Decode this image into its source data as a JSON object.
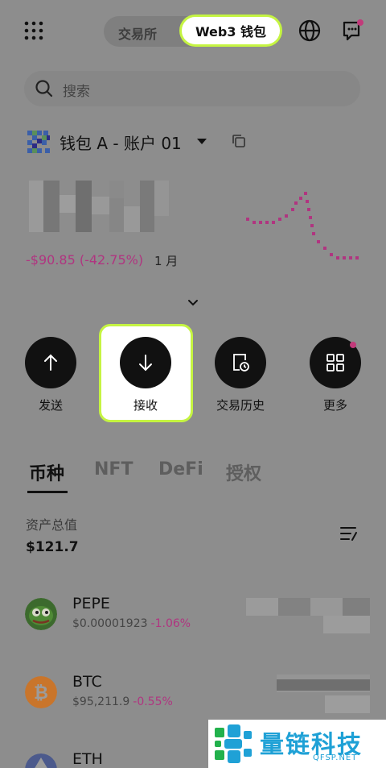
{
  "header": {
    "tab_exchange": "交易所",
    "tab_web3": "Web3 钱包",
    "has_notification": true
  },
  "search": {
    "placeholder": "搜索"
  },
  "wallet": {
    "name": "钱包 A - 账户 01"
  },
  "balance": {
    "change": "-$90.85 (-42.75%)",
    "period": "1 月"
  },
  "actions": [
    {
      "label": "发送",
      "icon": "arrow-up-icon"
    },
    {
      "label": "接收",
      "icon": "arrow-down-icon"
    },
    {
      "label": "交易历史",
      "icon": "history-icon"
    },
    {
      "label": "更多",
      "icon": "grid-icon"
    }
  ],
  "tabs": [
    {
      "label": "币种",
      "active": true
    },
    {
      "label": "NFT",
      "active": false
    },
    {
      "label": "DeFi",
      "active": false
    },
    {
      "label": "授权",
      "active": false
    }
  ],
  "assets": {
    "label": "资产总值",
    "value": "$121.7"
  },
  "coins": [
    {
      "symbol": "PEPE",
      "price": "$0.00001923",
      "change": "-1.06%"
    },
    {
      "symbol": "BTC",
      "price": "$95,211.9",
      "change": "-0.55%"
    },
    {
      "symbol": "ETH",
      "price": "",
      "change": ""
    }
  ],
  "watermark": {
    "title": "量链科技",
    "site": "QFSP.NET"
  },
  "colors": {
    "accent": "#c5f442",
    "negative": "#b03580",
    "background": "#8d8d8d"
  }
}
